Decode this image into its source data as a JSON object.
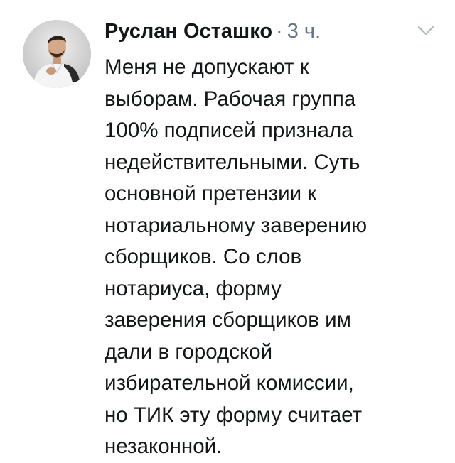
{
  "tweet": {
    "author_name": "Руслан Осташко",
    "separator": "·",
    "timestamp": "3 ч.",
    "menu_icon": "chevron-down-icon",
    "avatar_icon": "user-avatar",
    "text_lines": [
      "Меня не допускают к",
      "выборам. Рабочая группа",
      "100% подписей признала",
      "недействительными. Суть",
      "основной претензии к",
      "нотариальному заверению",
      "сборщиков. Со слов",
      "нотариуса, форму",
      "заверения сборщиков им",
      "дали в городской",
      "избирательной комиссии,",
      "но ТИК эту форму считает",
      "незаконной."
    ]
  },
  "colors": {
    "text": "#14171a",
    "muted": "#657786",
    "chevron": "#aab8c2",
    "background": "#ffffff"
  }
}
